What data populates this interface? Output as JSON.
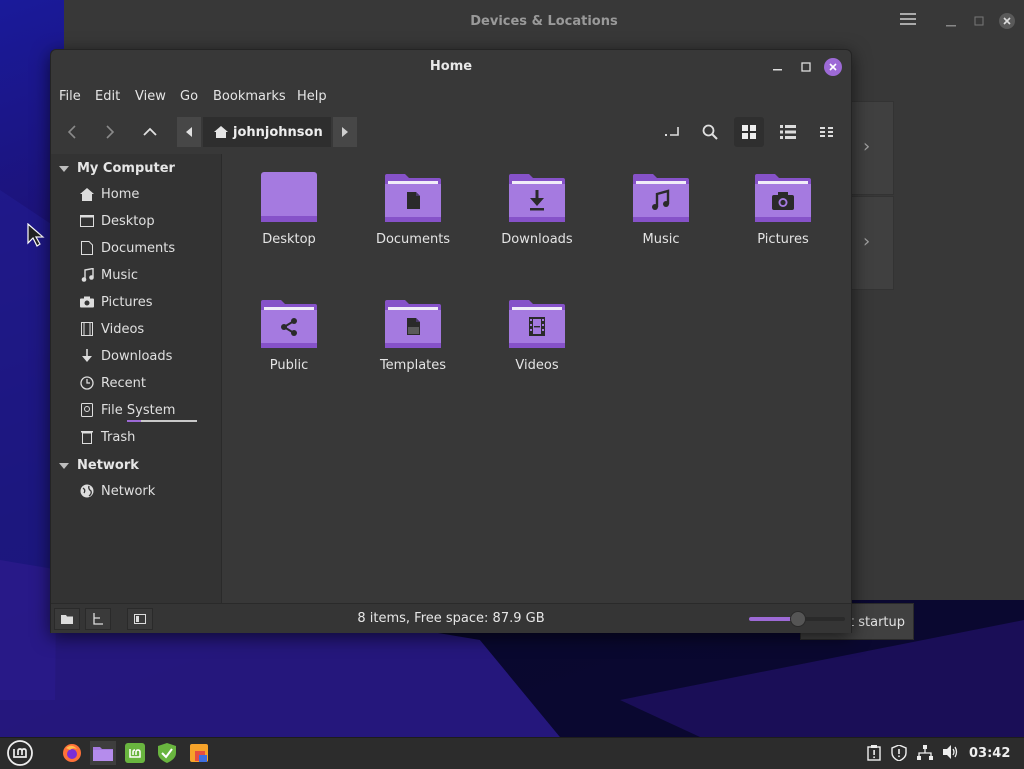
{
  "background_window": {
    "title": "Devices & Locations",
    "strip_text": "t startup"
  },
  "window": {
    "title": "Home"
  },
  "menu": [
    "File",
    "Edit",
    "View",
    "Go",
    "Bookmarks",
    "Help"
  ],
  "toolbar": {
    "back_icon": "chevron-left-icon",
    "forward_icon": "chevron-right-icon",
    "up_icon": "chevron-up-icon",
    "breadcrumb": "johnjohnson",
    "view_mode": "icons"
  },
  "sidebar": {
    "sections": [
      {
        "title": "My Computer",
        "items": [
          "Home",
          "Desktop",
          "Documents",
          "Music",
          "Pictures",
          "Videos",
          "Downloads",
          "Recent",
          "File System",
          "Trash"
        ]
      },
      {
        "title": "Network",
        "items": [
          "Network"
        ]
      }
    ]
  },
  "files": [
    {
      "name": "Desktop",
      "icon": "plain-folder-icon"
    },
    {
      "name": "Documents",
      "icon": "document-folder-icon"
    },
    {
      "name": "Downloads",
      "icon": "download-folder-icon"
    },
    {
      "name": "Music",
      "icon": "music-folder-icon"
    },
    {
      "name": "Pictures",
      "icon": "camera-folder-icon"
    },
    {
      "name": "Public",
      "icon": "share-folder-icon"
    },
    {
      "name": "Templates",
      "icon": "template-folder-icon"
    },
    {
      "name": "Videos",
      "icon": "film-folder-icon"
    }
  ],
  "status": {
    "text": "8 items, Free space: 87.9 GB",
    "zoom_fraction": 0.5
  },
  "taskbar": {
    "clock": "03:42"
  },
  "colors": {
    "accent": "#9d6ad6",
    "folder": "#a57ae0",
    "folder_dark": "#8652c9"
  }
}
